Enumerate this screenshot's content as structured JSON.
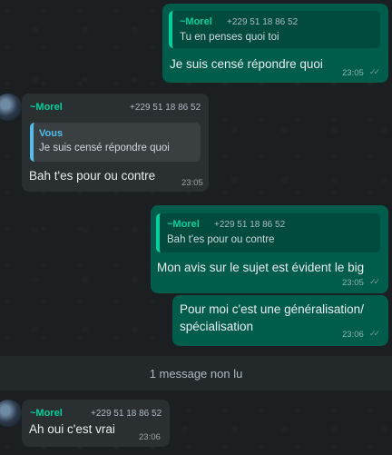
{
  "messages": [
    {
      "quote": {
        "author": "~Morel",
        "phone": "+229 51 18 86 52",
        "text": "Tu en penses quoi toi"
      },
      "text": "Je suis censé répondre quoi",
      "time": "23:05"
    },
    {
      "sender": "~Morel",
      "phone": "+229 51 18 86 52",
      "quote": {
        "author": "Vous",
        "text": "Je suis censé répondre quoi"
      },
      "text": "Bah t'es pour ou contre",
      "time": "23:05"
    },
    {
      "quote": {
        "author": "~Morel",
        "phone": "+229 51 18 86 52",
        "text": "Bah t'es pour ou contre"
      },
      "text": "Mon avis sur le sujet est évident le big",
      "time": "23:05"
    },
    {
      "text_line1": "Pour moi c'est une généralisation/",
      "text_line2": "spécialisation",
      "time": "23:06"
    },
    {
      "sender": "~Morel",
      "phone": "+229 51 18 86 52",
      "text": "Ah oui c'est vrai",
      "time": "23:06"
    }
  ],
  "unread": "1 message non lu",
  "ticks": "✓✓",
  "colors": {
    "outgoing": "#005c4b",
    "incoming": "#2a2f32",
    "accent": "#06cf9c",
    "self_quote": "#53bdeb"
  }
}
